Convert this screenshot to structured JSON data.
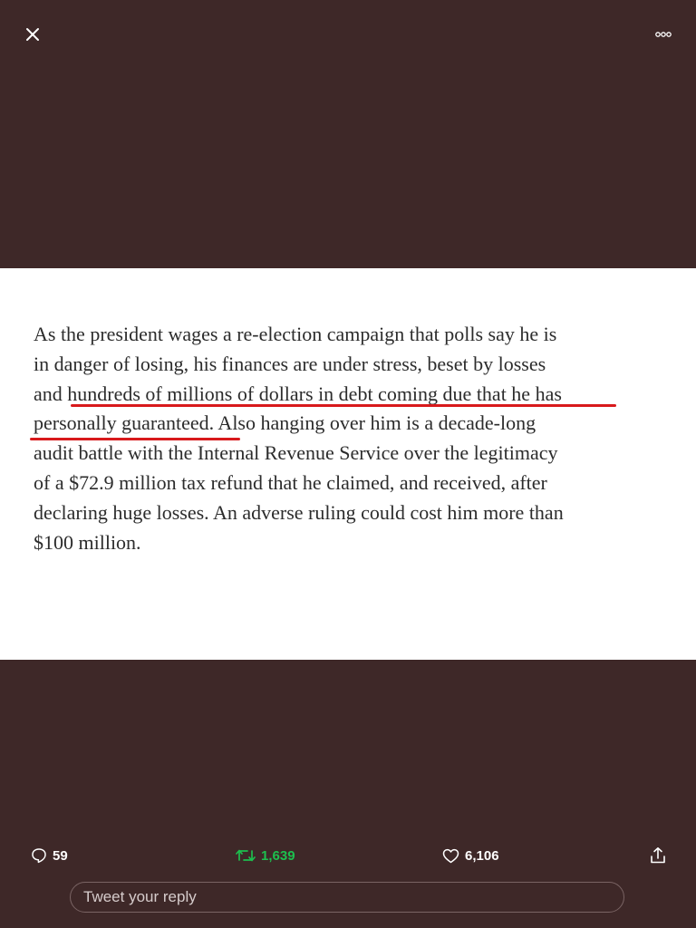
{
  "header": {
    "close_icon": "close-icon",
    "more_icon": "more-icon"
  },
  "article": {
    "lines": [
      "As the president wages a re-election campaign that polls say he is",
      "in danger of losing, his finances are under stress, beset by losses",
      "and hundreds of millions of dollars in debt coming due that he has",
      "personally guaranteed. Also hanging over him is a decade-long",
      "audit battle with the Internal Revenue Service over the legitimacy",
      "of a $72.9 million tax refund that he claimed, and received, after",
      "declaring huge losses. An adverse ruling could cost him more than",
      "$100 million."
    ],
    "underline_color": "#d8191c"
  },
  "actions": {
    "reply_count": "59",
    "retweet_count": "1,639",
    "like_count": "6,106",
    "reply_icon": "speech-bubble-icon",
    "retweet_icon": "retweet-icon",
    "like_icon": "heart-icon",
    "share_icon": "share-icon",
    "retweet_color": "#1dbf4e"
  },
  "reply": {
    "placeholder": "Tweet your reply"
  },
  "colors": {
    "background": "#3e2828",
    "image_background": "#ffffff",
    "text": "#2c2c2c"
  }
}
